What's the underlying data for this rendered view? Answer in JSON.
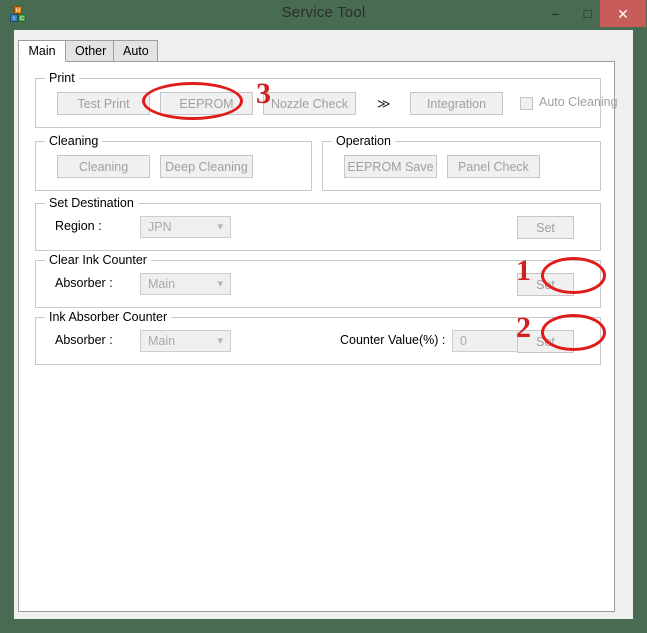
{
  "window": {
    "title": "Service Tool",
    "icon": "blocks-app-icon",
    "controls": {
      "minimize": "–",
      "maximize": "□",
      "close": "✕"
    },
    "titlebar_color": "#496b52",
    "close_color": "#c75c58"
  },
  "tabs": [
    {
      "label": "Main",
      "selected": true
    },
    {
      "label": "Other",
      "selected": false
    },
    {
      "label": "Auto",
      "selected": false
    }
  ],
  "groups": {
    "print": {
      "label": "Print",
      "buttons": [
        {
          "label": "Test Print"
        },
        {
          "label": "EEPROM"
        },
        {
          "label": "Nozzle Check"
        },
        {
          "label": "Integration"
        }
      ],
      "separator": "≫",
      "checkbox": {
        "label": "Auto Cleaning",
        "checked": false
      }
    },
    "cleaning": {
      "label": "Cleaning",
      "buttons": [
        {
          "label": "Cleaning"
        },
        {
          "label": "Deep Cleaning"
        }
      ]
    },
    "operation": {
      "label": "Operation",
      "buttons": [
        {
          "label": "EEPROM Save"
        },
        {
          "label": "Panel Check"
        }
      ]
    },
    "set_destination": {
      "label": "Set Destination",
      "region_label": "Region :",
      "region_value": "JPN",
      "set_label": "Set"
    },
    "clear_ink_counter": {
      "label": "Clear Ink Counter",
      "absorber_label": "Absorber :",
      "absorber_value": "Main",
      "set_label": "Set"
    },
    "ink_absorber_counter": {
      "label": "Ink Absorber Counter",
      "absorber_label": "Absorber :",
      "absorber_value": "Main",
      "counter_label": "Counter Value(%) :",
      "counter_value": "0",
      "set_label": "Set"
    }
  },
  "annotations": {
    "color": "#e01b1b",
    "marks": [
      {
        "number": "1",
        "target": "clear-ink-counter-set-button"
      },
      {
        "number": "2",
        "target": "ink-absorber-counter-set-button"
      },
      {
        "number": "3",
        "target": "eeprom-button"
      }
    ]
  }
}
